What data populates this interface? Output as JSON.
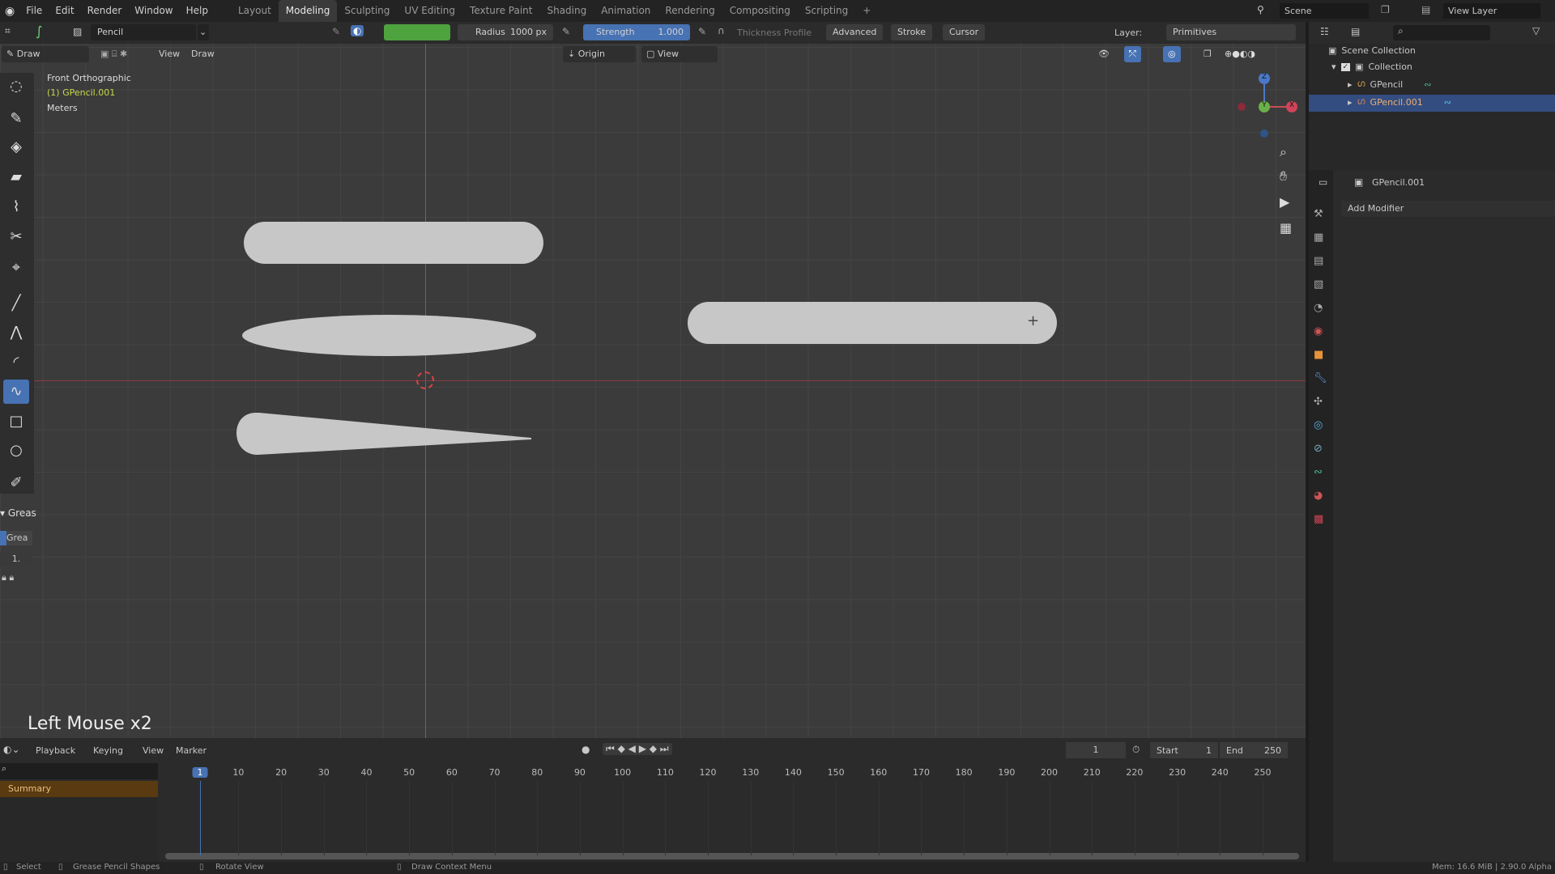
{
  "menubar": {
    "menus": [
      "File",
      "Edit",
      "Render",
      "Window",
      "Help"
    ],
    "workspaces": [
      "Layout",
      "Modeling",
      "Sculpting",
      "UV Editing",
      "Texture Paint",
      "Shading",
      "Animation",
      "Rendering",
      "Compositing",
      "Scripting"
    ],
    "active_workspace": "Modeling",
    "add": "+",
    "scene": "Scene",
    "view_layer": "View Layer"
  },
  "toolheader": {
    "brush": "Pencil",
    "color": "#4fa33e",
    "radius_label": "Radius",
    "radius_value": "1000 px",
    "strength_label": "Strength",
    "strength_value": "1.000",
    "strength_fill": 1.0,
    "thickness": "Thickness Profile",
    "advanced": "Advanced",
    "stroke": "Stroke",
    "cursor": "Cursor",
    "layer_label": "Layer:",
    "layer_value": "Primitives"
  },
  "viewport": {
    "mode": "Draw",
    "view": "View",
    "draw": "Draw",
    "origin": "Origin",
    "view2": "View",
    "info_view": "Front Orthographic",
    "info_object": "(1) GPencil.001",
    "info_units": "Meters",
    "last_op": "Left Mouse x2",
    "gizmo": {
      "z": "Z",
      "y": "Y",
      "x": "X"
    }
  },
  "sidebar": {
    "panel": "Greas",
    "layer": "Grea",
    "value": "1."
  },
  "outliner": {
    "root": "Scene Collection",
    "collection": "Collection",
    "items": [
      {
        "name": "GPencil",
        "selected": false
      },
      {
        "name": "GPencil.001",
        "selected": true
      }
    ]
  },
  "properties": {
    "object": "GPencil.001",
    "add_modifier": "Add Modifier"
  },
  "timeline": {
    "menus": [
      "Playback",
      "Keying",
      "View",
      "Marker"
    ],
    "current_frame": "1",
    "start_label": "Start",
    "start": "1",
    "end_label": "End",
    "end": "250",
    "summary": "Summary",
    "ticks": [
      "1",
      "10",
      "20",
      "30",
      "40",
      "50",
      "60",
      "70",
      "80",
      "90",
      "100",
      "110",
      "120",
      "130",
      "140",
      "150",
      "160",
      "170",
      "180",
      "190",
      "200",
      "210",
      "220",
      "230",
      "240",
      "250"
    ]
  },
  "status": {
    "select": "Select",
    "shapes": "Grease Pencil Shapes",
    "rotate": "Rotate View",
    "context": "Draw Context Menu",
    "info": "Mem: 16.6 MiB | 2.90.0 Alpha"
  }
}
